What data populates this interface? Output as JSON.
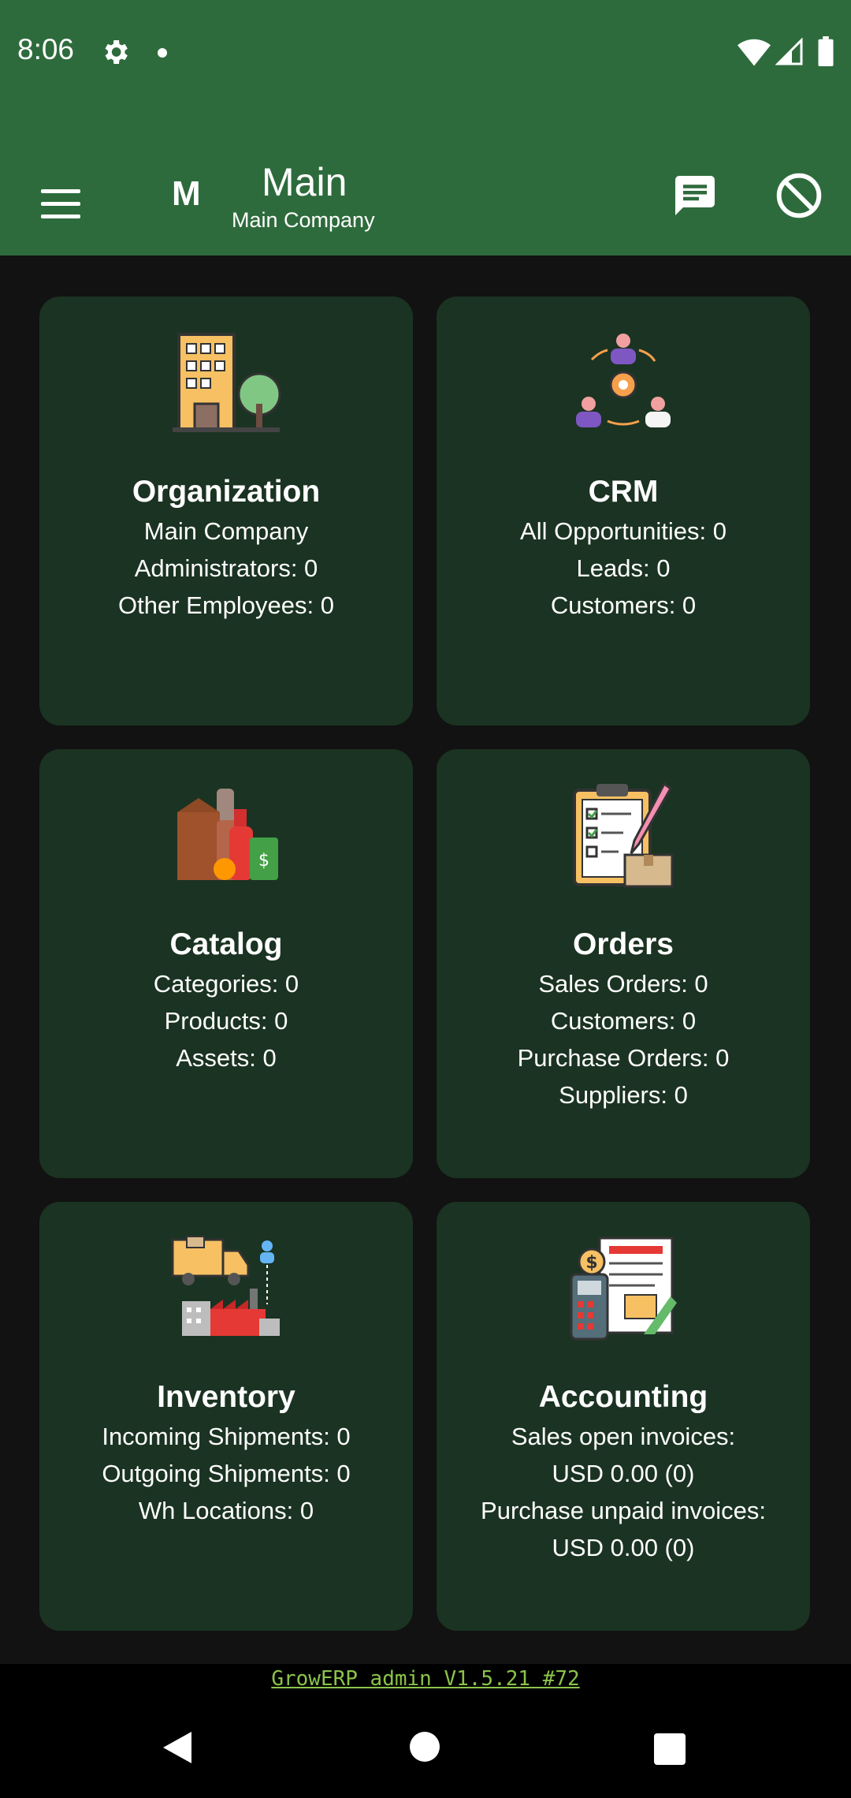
{
  "status_bar": {
    "time": "8:06"
  },
  "app_bar": {
    "avatar_letter": "M",
    "title": "Main",
    "subtitle": "Main Company"
  },
  "cards": [
    {
      "title": "Organization",
      "lines": [
        "Main Company",
        "Administrators: 0",
        "Other Employees: 0"
      ],
      "icon": "organization-building-icon"
    },
    {
      "title": "CRM",
      "lines": [
        "All Opportunities: 0",
        "Leads: 0",
        "Customers: 0"
      ],
      "icon": "crm-people-gear-icon"
    },
    {
      "title": "Catalog",
      "lines": [
        "Categories: 0",
        "Products: 0",
        "Assets: 0"
      ],
      "icon": "catalog-products-icon"
    },
    {
      "title": "Orders",
      "lines": [
        "Sales Orders: 0",
        "Customers: 0",
        "Purchase Orders: 0",
        "Suppliers: 0"
      ],
      "icon": "orders-clipboard-icon"
    },
    {
      "title": "Inventory",
      "lines": [
        "Incoming Shipments: 0",
        "Outgoing Shipments: 0",
        "Wh Locations: 0"
      ],
      "icon": "inventory-truck-factory-icon"
    },
    {
      "title": "Accounting",
      "lines": [
        "Sales open invoices:",
        "USD 0.00 (0)",
        "Purchase unpaid invoices:",
        "USD 0.00 (0)"
      ],
      "icon": "accounting-invoice-icon"
    }
  ],
  "footer": {
    "version": "GrowERP admin V1.5.21 #72"
  },
  "colors": {
    "primary": "#2e6b3c",
    "card": "#1b3322",
    "background": "#121212",
    "footer_link": "#8bc34a"
  }
}
